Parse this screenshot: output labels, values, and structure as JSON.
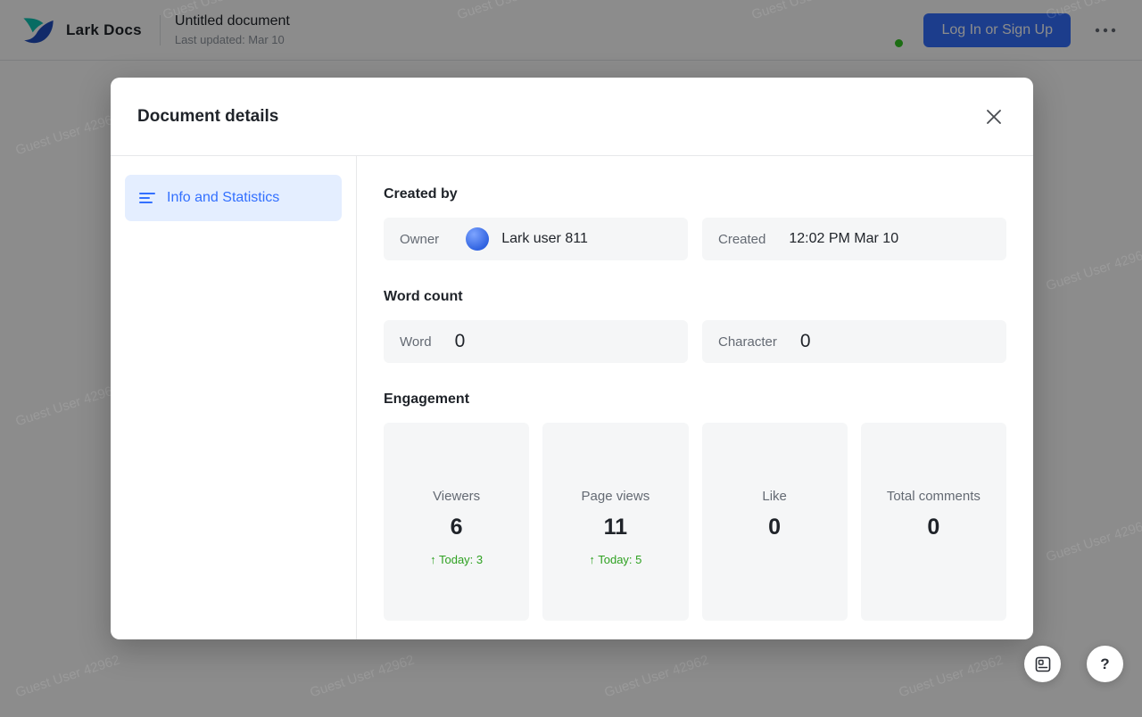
{
  "header": {
    "brand": "Lark Docs",
    "doc_title": "Untitled document",
    "last_updated": "Last updated: Mar 10",
    "login_button": "Log In or Sign Up"
  },
  "watermark": {
    "text": "Guest User 42962"
  },
  "modal": {
    "title": "Document details",
    "sidebar": {
      "items": [
        {
          "label": "Info and Statistics"
        }
      ]
    },
    "created_by": {
      "heading": "Created by",
      "owner_label": "Owner",
      "owner_name": "Lark user 811",
      "created_label": "Created",
      "created_value": "12:02 PM Mar 10"
    },
    "word_count": {
      "heading": "Word count",
      "word_label": "Word",
      "word_value": "0",
      "character_label": "Character",
      "character_value": "0"
    },
    "engagement": {
      "heading": "Engagement",
      "cards": [
        {
          "label": "Viewers",
          "value": "6",
          "today": "↑ Today: 3"
        },
        {
          "label": "Page views",
          "value": "11",
          "today": "↑ Today: 5"
        },
        {
          "label": "Like",
          "value": "0",
          "today": ""
        },
        {
          "label": "Total comments",
          "value": "0",
          "today": ""
        }
      ]
    }
  },
  "floating": {
    "help_label": "?"
  }
}
